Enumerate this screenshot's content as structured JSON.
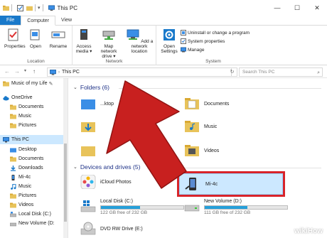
{
  "titlebar": {
    "title": "This PC",
    "minimize": "—",
    "maximize": "☐",
    "close": "✕"
  },
  "tabs": [
    "File",
    "Computer",
    "View"
  ],
  "ribbon": {
    "location_group": {
      "label": "Location",
      "buttons": [
        "Properties",
        "Open",
        "Rename"
      ]
    },
    "network_group": {
      "label": "Network",
      "buttons": [
        "Access media ▾",
        "Map network drive ▾",
        "Add a network location"
      ]
    },
    "system_group": {
      "label": "System",
      "open_settings": "Open Settings",
      "items": [
        "Uninstall or change a program",
        "System properties",
        "Manage"
      ]
    }
  },
  "address": {
    "back": "←",
    "forward": "→",
    "down": "▾",
    "up": "↑",
    "path": "This PC",
    "refresh": "↻",
    "search_placeholder": "Search This PC"
  },
  "nav": {
    "items": [
      {
        "label": "Music of my Life",
        "icon": "folder-icon",
        "pin": "✎"
      },
      {
        "label": "OneDrive",
        "icon": "cloud-icon"
      },
      {
        "label": "Documents",
        "icon": "folder-icon"
      },
      {
        "label": "Music",
        "icon": "folder-icon"
      },
      {
        "label": "Pictures",
        "icon": "folder-icon"
      },
      {
        "label": "This PC",
        "icon": "computer-icon"
      },
      {
        "label": "Desktop",
        "icon": "folder-icon"
      },
      {
        "label": "Documents",
        "icon": "folder-icon"
      },
      {
        "label": "Downloads",
        "icon": "download-icon"
      },
      {
        "label": "Mi-4c",
        "icon": "phone-icon"
      },
      {
        "label": "Music",
        "icon": "music-icon"
      },
      {
        "label": "Pictures",
        "icon": "folder-icon"
      },
      {
        "label": "Videos",
        "icon": "folder-icon"
      },
      {
        "label": "Local Disk (C:)",
        "icon": "drive-icon"
      },
      {
        "label": "New Volume (D:",
        "icon": "drive-icon"
      }
    ]
  },
  "content": {
    "folders_header": "Folders (6)",
    "folders": [
      "Desktop",
      "Documents",
      "Downloads",
      "Music",
      "Pictures",
      "Videos"
    ],
    "folders_visible": {
      "left": "...ktop",
      "right": [
        "Documents",
        "Music",
        "Videos"
      ]
    },
    "devices_header": "Devices and drives (5)",
    "devices": [
      {
        "name": "iCloud Photos",
        "icon": "icloud-photos-icon"
      },
      {
        "name": "Mi-4c",
        "icon": "phone-icon",
        "selected": true
      },
      {
        "name": "Local Disk (C:)",
        "free": "122 GB free of 232 GB",
        "used_fraction": 0.47
      },
      {
        "name": "New Volume (D:)",
        "free": "111 GB free of 232 GB",
        "used_fraction": 0.52
      },
      {
        "name": "DVD RW Drive (E:)",
        "icon": "dvd-icon"
      }
    ]
  },
  "watermark": "wikiHow",
  "colors": {
    "file_tab": "#1979ca",
    "selection": "#cce8ff",
    "highlight_border": "#d8242a",
    "arrow": "#c8201f",
    "section_header": "#1e3287",
    "drive_fill": "#26a0da"
  }
}
